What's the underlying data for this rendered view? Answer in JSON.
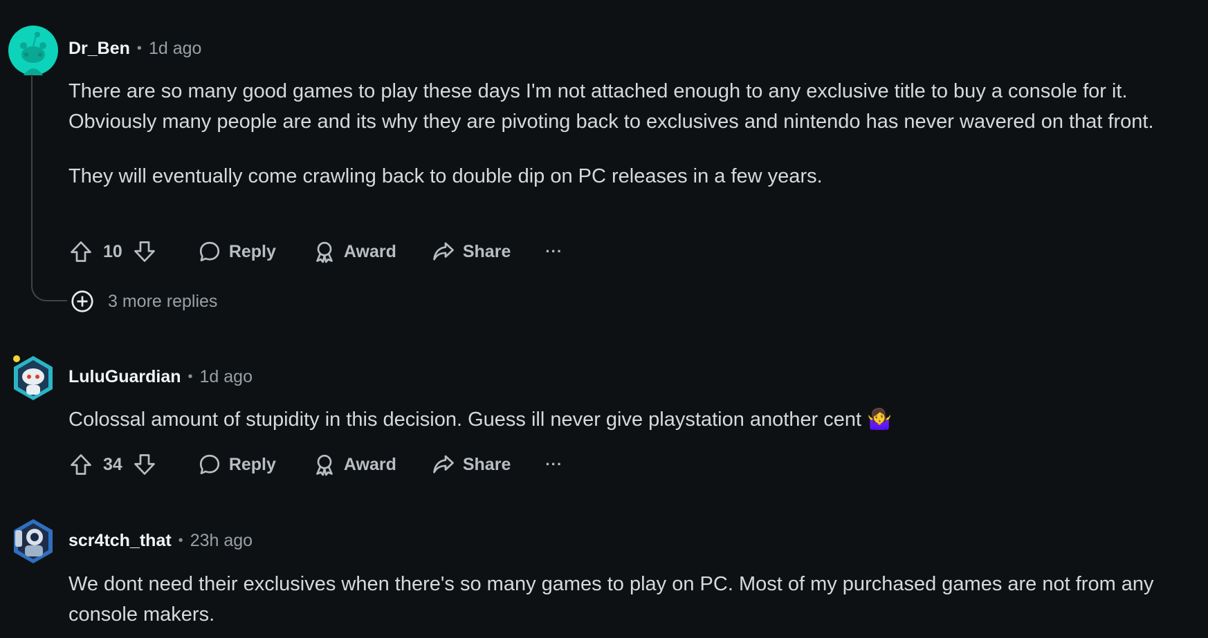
{
  "comments": [
    {
      "author": "Dr_Ben",
      "time": "1d ago",
      "paragraphs": [
        "There are so many good games to play these days I'm not attached enough to any exclusive title to buy a console for it. Obviously many people are and its why they are pivoting back to exclusives and nintendo has never wavered on that front.",
        "They will eventually come crawling back to double dip on PC releases in a few years."
      ],
      "votes": "10",
      "more_replies": "3 more replies",
      "avatar_color": "#0dd3bb"
    },
    {
      "author": "LuluGuardian",
      "time": "1d ago",
      "paragraphs": [
        "Colossal amount of stupidity in this decision. Guess ill never give playstation another cent 🤷‍♀️"
      ],
      "votes": "34",
      "avatar_color": "#2ab5c7"
    },
    {
      "author": "scr4tch_that",
      "time": "23h ago",
      "paragraphs": [
        "We dont need their exclusives when there's so many games to play on PC. Most of my purchased games are not from any console makers."
      ],
      "avatar_color": "#2f6fbf"
    }
  ],
  "actions": {
    "reply": "Reply",
    "award": "Award",
    "share": "Share",
    "more": "···"
  },
  "icons": {
    "upvote": "upvote-arrow-icon",
    "downvote": "downvote-arrow-icon",
    "reply": "speech-bubble-icon",
    "award": "award-ribbon-icon",
    "share": "share-arrow-icon",
    "more": "ellipsis-icon",
    "expand": "plus-circle-icon"
  },
  "colors": {
    "background": "#0e1113",
    "text": "#d7dadc",
    "muted": "#98a0a6",
    "author": "#f2f4f5"
  }
}
